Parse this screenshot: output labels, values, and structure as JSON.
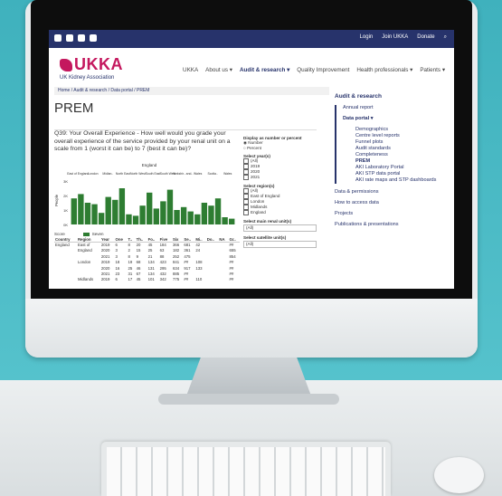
{
  "social": [
    "linkedin-icon",
    "twitter-icon",
    "instagram-icon",
    "youtube-icon"
  ],
  "toplinks": [
    "Login",
    "Join UKKA",
    "Donate"
  ],
  "brand": {
    "name": "UKKA",
    "tagline": "UK Kidney Association",
    "color": "#c4185e",
    "navy": "#27336b"
  },
  "nav": [
    "UKKA",
    "About us ▾",
    "Audit & research ▾",
    "Quality Improvement",
    "Health professionals ▾",
    "Patients ▾"
  ],
  "breadcrumb": "Home  /  Audit & research  /  Data portal  /  PREM",
  "page_title": "PREM",
  "question": "Q39: Your Overall Experience - How well would you grade your overall experience of the service provided by your renal unit on a scale from 1 (worst it can be) to 7 (best it can be)?",
  "chart": {
    "region_header": "England",
    "regions": [
      "East of England",
      "London",
      "Midlan..",
      "North East",
      "North West",
      "South East",
      "South West",
      "Yorkshir.. and..",
      "Wales",
      "Scotla..",
      "Wales"
    ],
    "ylabel": "People",
    "yticks": [
      "3K",
      "2K",
      "1K",
      "0K"
    ],
    "legend_label": "Score",
    "legend_series": "Seven"
  },
  "chart_data": {
    "type": "bar",
    "ylabel": "People",
    "ylim": [
      0,
      3000
    ],
    "series": [
      {
        "name": "Seven",
        "color": "#2e7d32",
        "values": [
          1800,
          2100,
          1500,
          1400,
          800,
          1900,
          1700,
          2500,
          700,
          600,
          1300,
          2200,
          1100,
          1600,
          2400,
          1000,
          1200,
          900,
          700,
          1500,
          1300,
          1800,
          500,
          400
        ]
      }
    ]
  },
  "table": {
    "headers": [
      "Country",
      "Region",
      "Year",
      "One",
      "T..",
      "Th..",
      "Fo..",
      "Five",
      "Six",
      "Se..",
      "Mi..",
      "Do..",
      "NA",
      "Gr.."
    ],
    "rows": [
      [
        "England",
        "East of",
        "2019",
        "6",
        "8",
        "20",
        "45",
        "184",
        "366",
        "681",
        "42",
        "",
        "",
        "##"
      ],
      [
        "",
        "England",
        "2020",
        "3",
        "2",
        "15",
        "25",
        "63",
        "182",
        "361",
        "24",
        "",
        "",
        "655"
      ],
      [
        "",
        "",
        "2021",
        "3",
        "8",
        "9",
        "21",
        "88",
        "252",
        "475",
        "",
        "",
        "",
        "854"
      ],
      [
        "",
        "London",
        "2019",
        "18",
        "19",
        "68",
        "134",
        "423",
        "841",
        "##",
        "108",
        "",
        "",
        "##"
      ],
      [
        "",
        "",
        "2020",
        "16",
        "25",
        "46",
        "131",
        "295",
        "634",
        "917",
        "133",
        "",
        "",
        "##"
      ],
      [
        "",
        "",
        "2021",
        "23",
        "31",
        "67",
        "134",
        "432",
        "885",
        "##",
        "",
        "",
        "",
        "##"
      ],
      [
        "",
        "Midlands",
        "2019",
        "6",
        "17",
        "45",
        "101",
        "342",
        "775",
        "##",
        "110",
        "",
        "",
        "##"
      ]
    ]
  },
  "filters": {
    "display_title": "Display as number or percent",
    "display_opts": [
      "Number",
      "Percent"
    ],
    "year_title": "Select year(s)",
    "years": [
      "(All)",
      "2019",
      "2020",
      "2021"
    ],
    "region_title": "Select region(s)",
    "regions": [
      "(All)",
      "East of England",
      "London",
      "Midlands",
      "England",
      "North East"
    ],
    "main_unit_title": "Select main renal unit(s)",
    "main_unit_value": "(All)",
    "sat_unit_title": "Select satellite unit(s)",
    "sat_unit_value": "(All)"
  },
  "sidebar": {
    "title": "Audit & research",
    "items": [
      "Annual report",
      "Data portal ▾"
    ],
    "sub": [
      "Demographics",
      "Centre level reports",
      "Funnel plots",
      "Audit standards",
      "Completeness",
      "PREM",
      "AKI Laboratory Portal",
      "AKI STP data portal",
      "AKI rate maps and STP dashboards"
    ],
    "after": [
      "Data & permissions",
      "How to access data",
      "Projects",
      "Publications & presentations"
    ]
  }
}
